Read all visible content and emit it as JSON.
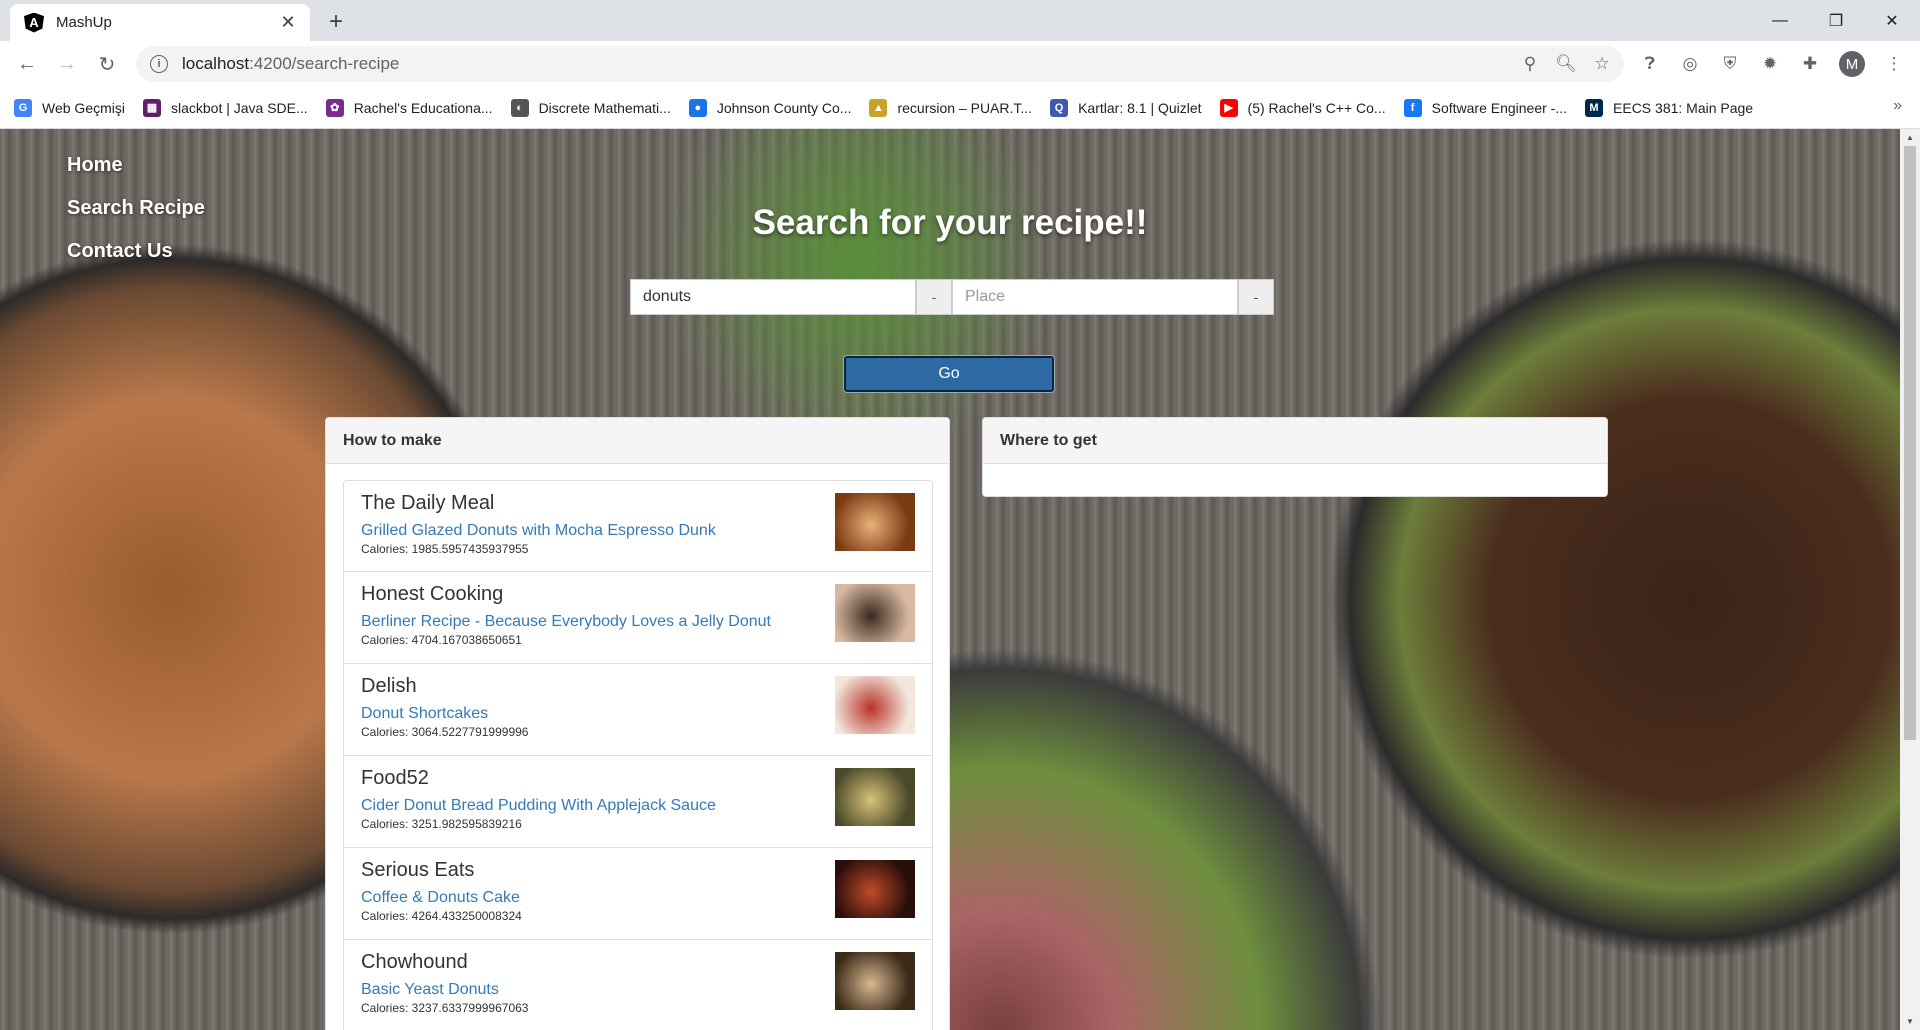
{
  "browser": {
    "tab_title": "MashUp",
    "tab_favicon_letter": "A",
    "tab_close": "✕",
    "new_tab": "+",
    "url_host": "localhost",
    "url_path": ":4200/search-recipe",
    "avatar_letter": "M",
    "bookmarks": [
      {
        "label": "Web Geçmişi",
        "icon": "G",
        "color": "#4285f4"
      },
      {
        "label": "slackbot | Java SDE...",
        "icon": "▦",
        "color": "#611f69"
      },
      {
        "label": "Rachel's Educationa...",
        "icon": "✿",
        "color": "#7b2d8e"
      },
      {
        "label": "Discrete Mathemati...",
        "icon": "◐",
        "color": "#555555"
      },
      {
        "label": "Johnson County Co...",
        "icon": "●",
        "color": "#1a73e8"
      },
      {
        "label": "recursion – PUAR.T...",
        "icon": "▲",
        "color": "#c9a227"
      },
      {
        "label": "Kartlar: 8.1 | Quizlet",
        "icon": "Q",
        "color": "#4257b2"
      },
      {
        "label": "(5) Rachel's C++ Co...",
        "icon": "▶",
        "color": "#ff0000"
      },
      {
        "label": "Software Engineer -...",
        "icon": "f",
        "color": "#1877f2"
      },
      {
        "label": "EECS 381: Main Page",
        "icon": "M",
        "color": "#00274c"
      }
    ]
  },
  "nav": {
    "home": "Home",
    "search_recipe": "Search Recipe",
    "contact_us": "Contact Us"
  },
  "hero": {
    "title": "Search for your recipe!!"
  },
  "search": {
    "query_value": "donuts",
    "query_addon": "-",
    "place_placeholder": "Place",
    "place_addon": "-",
    "go_label": "Go"
  },
  "how_to_make": {
    "heading": "How to make",
    "items": [
      {
        "source": "The Daily Meal",
        "title": "Grilled Glazed Donuts with Mocha Espresso Dunk",
        "calories": "Calories: 1985.5957435937955"
      },
      {
        "source": "Honest Cooking",
        "title": "Berliner Recipe - Because Everybody Loves a Jelly Donut",
        "calories": "Calories: 4704.167038650651"
      },
      {
        "source": "Delish",
        "title": "Donut Shortcakes",
        "calories": "Calories: 3064.5227791999996"
      },
      {
        "source": "Food52",
        "title": "Cider Donut Bread Pudding With Applejack Sauce",
        "calories": "Calories: 3251.982595839216"
      },
      {
        "source": "Serious Eats",
        "title": "Coffee & Donuts Cake",
        "calories": "Calories: 4264.433250008324"
      },
      {
        "source": "Chowhound",
        "title": "Basic Yeast Donuts",
        "calories": "Calories: 3237.6337999967063"
      }
    ]
  },
  "where_to_get": {
    "heading": "Where to get"
  }
}
